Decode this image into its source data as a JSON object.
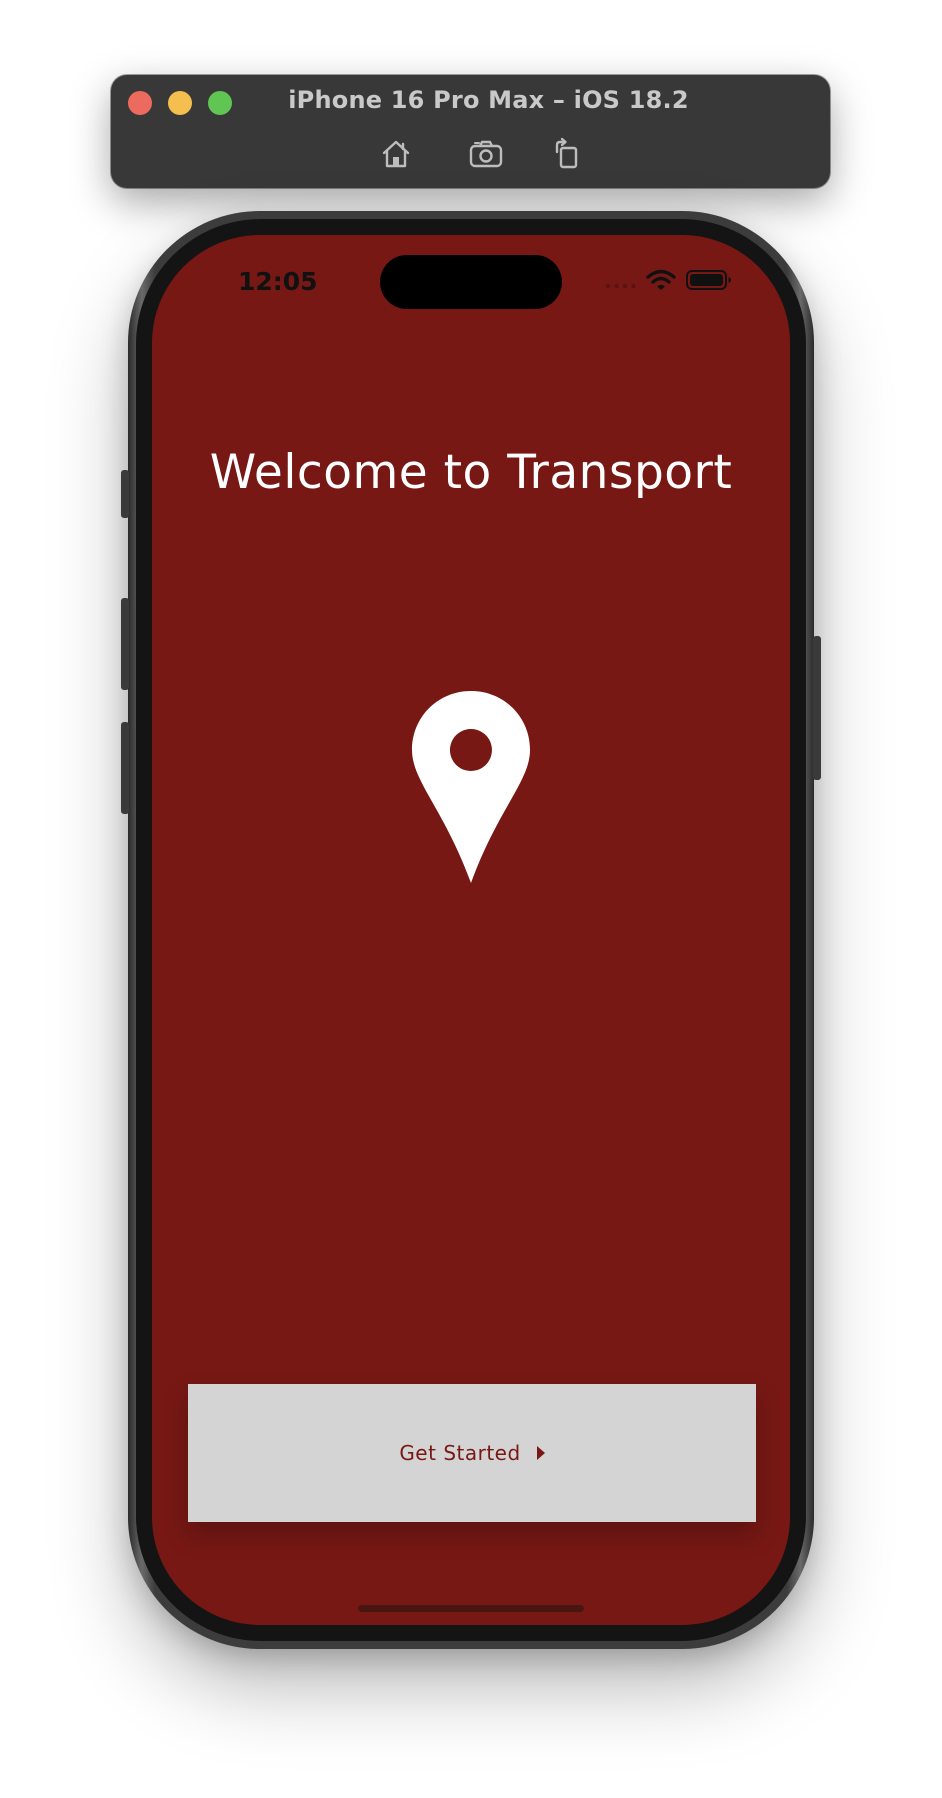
{
  "simulator": {
    "title": "iPhone 16 Pro Max – iOS 18.2",
    "toolbar_icons": [
      "home-icon",
      "screenshot-icon",
      "rotate-icon"
    ]
  },
  "status_bar": {
    "time": "12:05",
    "icons": [
      "signal-icon",
      "wifi-icon",
      "battery-icon"
    ]
  },
  "app": {
    "title": "Welcome to Transport",
    "hero_icon": "location-pin-icon",
    "cta_label": "Get Started",
    "cta_icon": "caret-right-icon"
  },
  "colors": {
    "background": "#771814",
    "button_background": "#d4d4d4",
    "button_text": "#771814",
    "title_text": "#ffffff"
  }
}
